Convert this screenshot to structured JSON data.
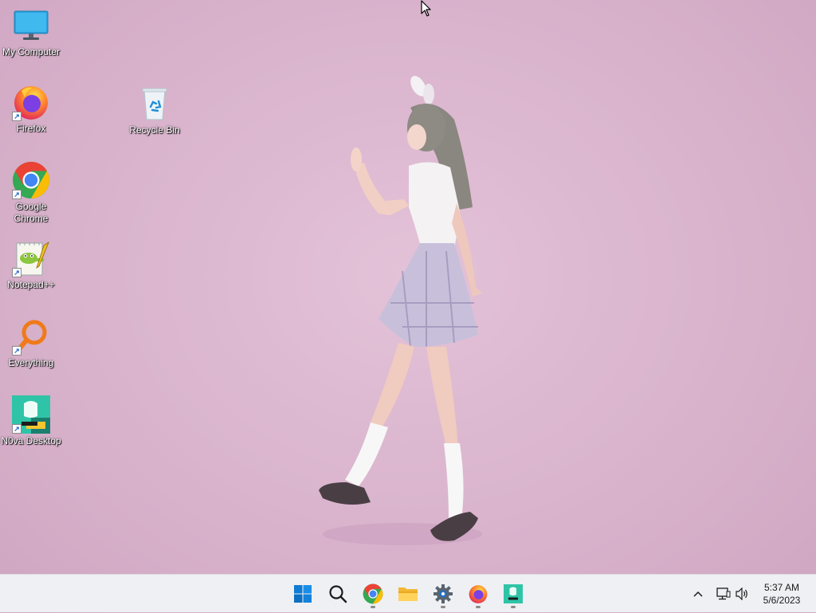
{
  "desktop": {
    "icons": [
      {
        "label": "My Computer",
        "icon": "monitor-icon"
      },
      {
        "label": "Firefox",
        "icon": "firefox-icon"
      },
      {
        "label": "Recycle Bin",
        "icon": "recycle-bin-icon"
      },
      {
        "label": "Google Chrome",
        "icon": "chrome-icon"
      },
      {
        "label": "Notepad++",
        "icon": "notepad-plus-plus-icon"
      },
      {
        "label": "Everything",
        "icon": "everything-search-icon"
      },
      {
        "label": "N0va Desktop",
        "icon": "n0va-desktop-icon"
      }
    ]
  },
  "taskbar": {
    "apps": [
      {
        "name": "Start",
        "icon": "windows-start-icon"
      },
      {
        "name": "Search",
        "icon": "search-icon"
      },
      {
        "name": "Google Chrome",
        "icon": "chrome-icon",
        "running": true
      },
      {
        "name": "File Explorer",
        "icon": "folder-icon"
      },
      {
        "name": "Settings",
        "icon": "gear-icon",
        "running": true
      },
      {
        "name": "Firefox",
        "icon": "firefox-icon",
        "running": true
      },
      {
        "name": "N0va Desktop",
        "icon": "n0va-desktop-icon",
        "running": true
      }
    ],
    "tray": {
      "chevron": "chevron-up-icon",
      "network": "network-icon",
      "volume": "volume-icon"
    },
    "clock": {
      "time": "5:37 AM",
      "date": "5/6/2023"
    }
  },
  "colors": {
    "wallpaper": "#dbb5cd",
    "taskbar": "#eef0f3",
    "label_text": "#ffffff"
  }
}
